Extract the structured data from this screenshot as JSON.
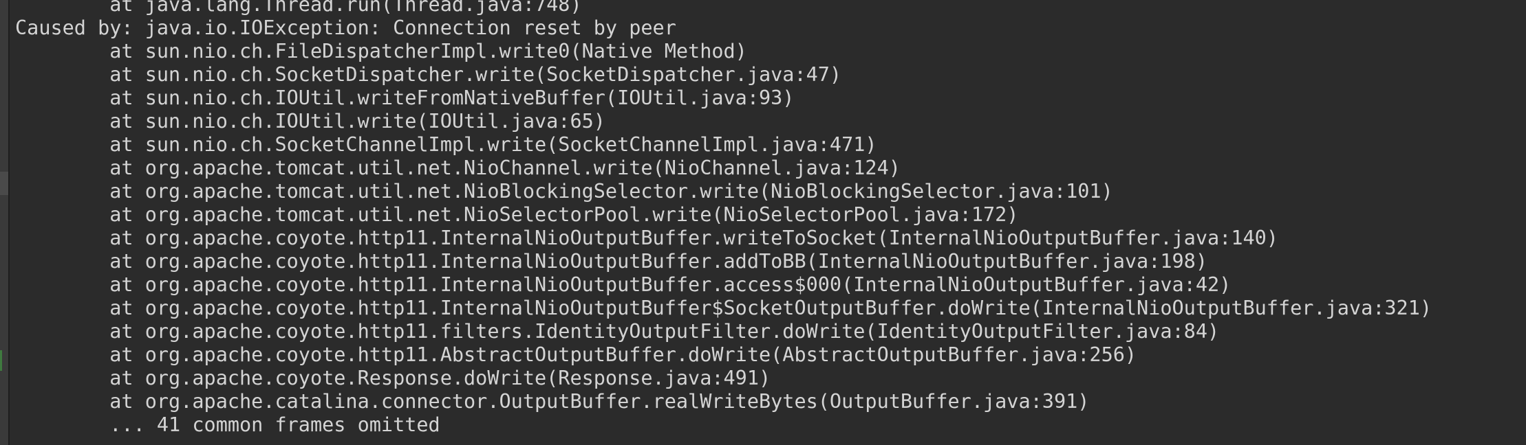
{
  "console": {
    "lines": [
      "        at java.lang.Thread.run(Thread.java:748)",
      "Caused by: java.io.IOException: Connection reset by peer",
      "        at sun.nio.ch.FileDispatcherImpl.write0(Native Method)",
      "        at sun.nio.ch.SocketDispatcher.write(SocketDispatcher.java:47)",
      "        at sun.nio.ch.IOUtil.writeFromNativeBuffer(IOUtil.java:93)",
      "        at sun.nio.ch.IOUtil.write(IOUtil.java:65)",
      "        at sun.nio.ch.SocketChannelImpl.write(SocketChannelImpl.java:471)",
      "        at org.apache.tomcat.util.net.NioChannel.write(NioChannel.java:124)",
      "        at org.apache.tomcat.util.net.NioBlockingSelector.write(NioBlockingSelector.java:101)",
      "        at org.apache.tomcat.util.net.NioSelectorPool.write(NioSelectorPool.java:172)",
      "        at org.apache.coyote.http11.InternalNioOutputBuffer.writeToSocket(InternalNioOutputBuffer.java:140)",
      "        at org.apache.coyote.http11.InternalNioOutputBuffer.addToBB(InternalNioOutputBuffer.java:198)",
      "        at org.apache.coyote.http11.InternalNioOutputBuffer.access$000(InternalNioOutputBuffer.java:42)",
      "        at org.apache.coyote.http11.InternalNioOutputBuffer$SocketOutputBuffer.doWrite(InternalNioOutputBuffer.java:321)",
      "        at org.apache.coyote.http11.filters.IdentityOutputFilter.doWrite(IdentityOutputFilter.java:84)",
      "        at org.apache.coyote.http11.AbstractOutputBuffer.doWrite(AbstractOutputBuffer.java:256)",
      "        at org.apache.coyote.Response.doWrite(Response.java:491)",
      "        at org.apache.catalina.connector.OutputBuffer.realWriteBytes(OutputBuffer.java:391)",
      "        ... 41 common frames omitted"
    ]
  },
  "colors": {
    "background": "#2b2b2b",
    "text": "#d4d4d4",
    "gutter": "#3a3a3a"
  }
}
